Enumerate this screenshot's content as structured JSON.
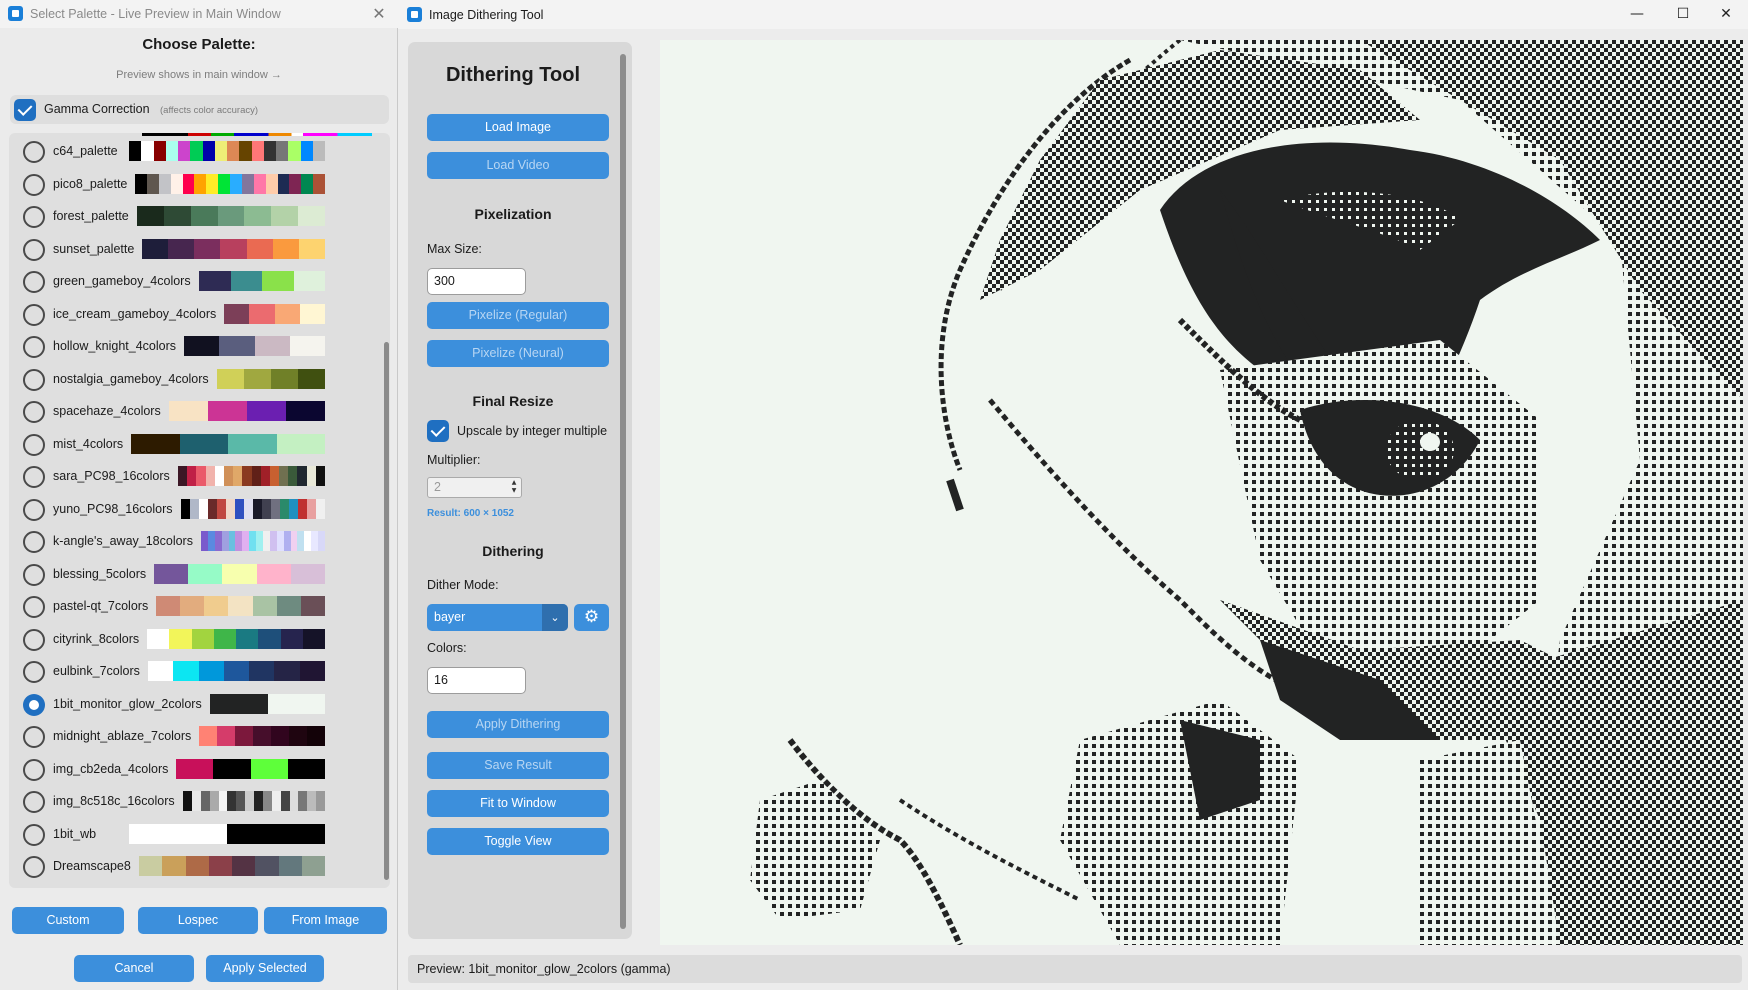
{
  "palette_dialog": {
    "title": "Select Palette - Live Preview in Main Window",
    "heading": "Choose Palette:",
    "hint": "Preview shows in main window →",
    "gamma": {
      "label": "Gamma Correction",
      "note": "(affects color accuracy)",
      "checked": true
    },
    "palettes": [
      {
        "name": "c64_palette",
        "selected": false,
        "colors": [
          "#000000",
          "#ffffff",
          "#880000",
          "#aaffee",
          "#cc44cc",
          "#00cc55",
          "#0000aa",
          "#eeee77",
          "#dd8855",
          "#664400",
          "#ff7777",
          "#333333",
          "#777777",
          "#aaff66",
          "#0088ff",
          "#bbbbbb"
        ]
      },
      {
        "name": "pico8_palette",
        "selected": false,
        "colors": [
          "#000000",
          "#5f574f",
          "#c2c3c7",
          "#fff1e8",
          "#ff004d",
          "#ffa300",
          "#ffec27",
          "#00e436",
          "#29adff",
          "#83769c",
          "#ff77a8",
          "#ffccaa",
          "#1d2b53",
          "#7e2553",
          "#008751",
          "#ab5236"
        ]
      },
      {
        "name": "forest_palette",
        "selected": false,
        "colors": [
          "#1a2a1c",
          "#2e4a35",
          "#4a7a5a",
          "#6a9a7c",
          "#8cbb92",
          "#b3d2a8",
          "#dcebd3"
        ]
      },
      {
        "name": "sunset_palette",
        "selected": false,
        "colors": [
          "#1e1e3a",
          "#47264f",
          "#7b2e5e",
          "#b8405e",
          "#ea6a52",
          "#fa9a3e",
          "#fdd36f"
        ]
      },
      {
        "name": "green_gameboy_4colors",
        "selected": false,
        "colors": [
          "#2e2b54",
          "#3b8d8f",
          "#8ae14a",
          "#dff1dc"
        ]
      },
      {
        "name": "ice_cream_gameboy_4colors",
        "selected": false,
        "colors": [
          "#7c3f58",
          "#eb6b6f",
          "#f9a875",
          "#fff6d3"
        ]
      },
      {
        "name": "hollow_knight_4colors",
        "selected": false,
        "colors": [
          "#111120",
          "#5a5e7e",
          "#cbb9c3",
          "#f5f4ee"
        ]
      },
      {
        "name": "nostalgia_gameboy_4colors",
        "selected": false,
        "colors": [
          "#d0d058",
          "#a0a840",
          "#708028",
          "#405010"
        ]
      },
      {
        "name": "spacehaze_4colors",
        "selected": false,
        "colors": [
          "#f8e3c4",
          "#cc3495",
          "#6b1fb1",
          "#0b0630"
        ]
      },
      {
        "name": "mist_4colors",
        "selected": false,
        "colors": [
          "#2d1b00",
          "#1e606e",
          "#5ab9a8",
          "#c4f0c2"
        ]
      },
      {
        "name": "sara_PC98_16colors",
        "selected": false,
        "colors": [
          "#3b1725",
          "#c02046",
          "#ea5a6a",
          "#f1b3ac",
          "#ffffff",
          "#d09058",
          "#e0a868",
          "#8a3a20",
          "#602018",
          "#a02028",
          "#c86030",
          "#707050",
          "#3a5a3a",
          "#202830",
          "#e8e8d8",
          "#101010"
        ]
      },
      {
        "name": "yuno_PC98_16colors",
        "selected": false,
        "colors": [
          "#000000",
          "#b0b8c8",
          "#ffffff",
          "#6a2a2a",
          "#c04840",
          "#f0d8c8",
          "#3050c0",
          "#e0e0f0",
          "#1a1a2a",
          "#404050",
          "#707080",
          "#2a8a6a",
          "#2090c0",
          "#c03030",
          "#e8a0a0",
          "#f0f0f0"
        ]
      },
      {
        "name": "k-angle's_away_18colors",
        "selected": false,
        "colors": [
          "#7a5acc",
          "#5a8ae0",
          "#8a6ad0",
          "#a0a0e0",
          "#6ac0e0",
          "#c090e0",
          "#e0b0f0",
          "#70e0f0",
          "#a0f0f0",
          "#f0f0f0",
          "#d0c0f0",
          "#e0e0ff",
          "#b0b0f0",
          "#f0d0f0",
          "#c0e0f0",
          "#ffffff",
          "#e8e8ff",
          "#d8d8f8"
        ]
      },
      {
        "name": "blessing_5colors",
        "selected": false,
        "colors": [
          "#74569b",
          "#96fbc7",
          "#f7ffae",
          "#ffb3cb",
          "#d8bfd8"
        ]
      },
      {
        "name": "pastel-qt_7colors",
        "selected": false,
        "colors": [
          "#cf8a75",
          "#e2ac7e",
          "#f0cc8e",
          "#f3e3c3",
          "#a9c3a4",
          "#6e8b80",
          "#6a4f57"
        ]
      },
      {
        "name": "cityrink_8colors",
        "selected": false,
        "colors": [
          "#ffffff",
          "#f2f55a",
          "#a2d43f",
          "#3fb649",
          "#1a7a82",
          "#1e4f7a",
          "#26244e",
          "#151328"
        ]
      },
      {
        "name": "eulbink_7colors",
        "selected": false,
        "colors": [
          "#ffffff",
          "#0ce6f2",
          "#0098db",
          "#1e579c",
          "#203562",
          "#252446",
          "#201533"
        ]
      },
      {
        "name": "1bit_monitor_glow_2colors",
        "selected": true,
        "colors": [
          "#222323",
          "#f0f6f0"
        ]
      },
      {
        "name": "midnight_ablaze_7colors",
        "selected": false,
        "colors": [
          "#ff8274",
          "#d53c6a",
          "#7c183c",
          "#460e2b",
          "#31051e",
          "#1f0510",
          "#130208"
        ]
      },
      {
        "name": "img_cb2eda_4colors",
        "selected": false,
        "colors": [
          "#c8105a",
          "#000000",
          "#5eff3a",
          "#000000"
        ]
      },
      {
        "name": "img_8c518c_16colors",
        "selected": false,
        "colors": [
          "#111111",
          "#e8e8e8",
          "#666666",
          "#aaaaaa",
          "#f4f4f4",
          "#333333",
          "#555555",
          "#cccccc",
          "#222222",
          "#888888",
          "#eeeeee",
          "#444444",
          "#dddddd",
          "#777777",
          "#bbbbbb",
          "#999999"
        ]
      },
      {
        "name": "1bit_wb",
        "selected": false,
        "colors": [
          "#ffffff",
          "#000000"
        ]
      },
      {
        "name": "Dreamscape8",
        "selected": false,
        "colors": [
          "#c9cca1",
          "#caa05a",
          "#ae6a47",
          "#8b4049",
          "#543344",
          "#515262",
          "#63787d",
          "#8ea091"
        ]
      }
    ],
    "buttons": {
      "custom": "Custom",
      "lospec": "Lospec",
      "from_image": "From Image",
      "cancel": "Cancel",
      "apply": "Apply Selected"
    }
  },
  "main_window": {
    "title": "Image Dithering Tool",
    "controls": {
      "minimize": "—",
      "maximize": "☐",
      "close": "✕"
    },
    "sidebar": {
      "heading": "Dithering Tool",
      "load_image": "Load Image",
      "load_video": "Load Video",
      "pixelization": {
        "heading": "Pixelization",
        "max_size_label": "Max Size:",
        "max_size_value": "300",
        "pixelize_regular": "Pixelize (Regular)",
        "pixelize_neural": "Pixelize (Neural)"
      },
      "final_resize": {
        "heading": "Final Resize",
        "upscale_label": "Upscale by integer multiple",
        "upscale_checked": true,
        "multiplier_label": "Multiplier:",
        "multiplier_value": "2",
        "result_text": "Result: 600 × 1052"
      },
      "dithering": {
        "heading": "Dithering",
        "mode_label": "Dither Mode:",
        "mode_value": "bayer",
        "colors_label": "Colors:",
        "colors_value": "16",
        "apply": "Apply Dithering"
      },
      "save_result": "Save Result",
      "fit_to_window": "Fit to Window",
      "toggle_view": "Toggle View"
    },
    "preview": {
      "foreground": "#222323",
      "background": "#f0f6f0"
    },
    "status": "Preview: 1bit_monitor_glow_2colors (gamma)"
  }
}
